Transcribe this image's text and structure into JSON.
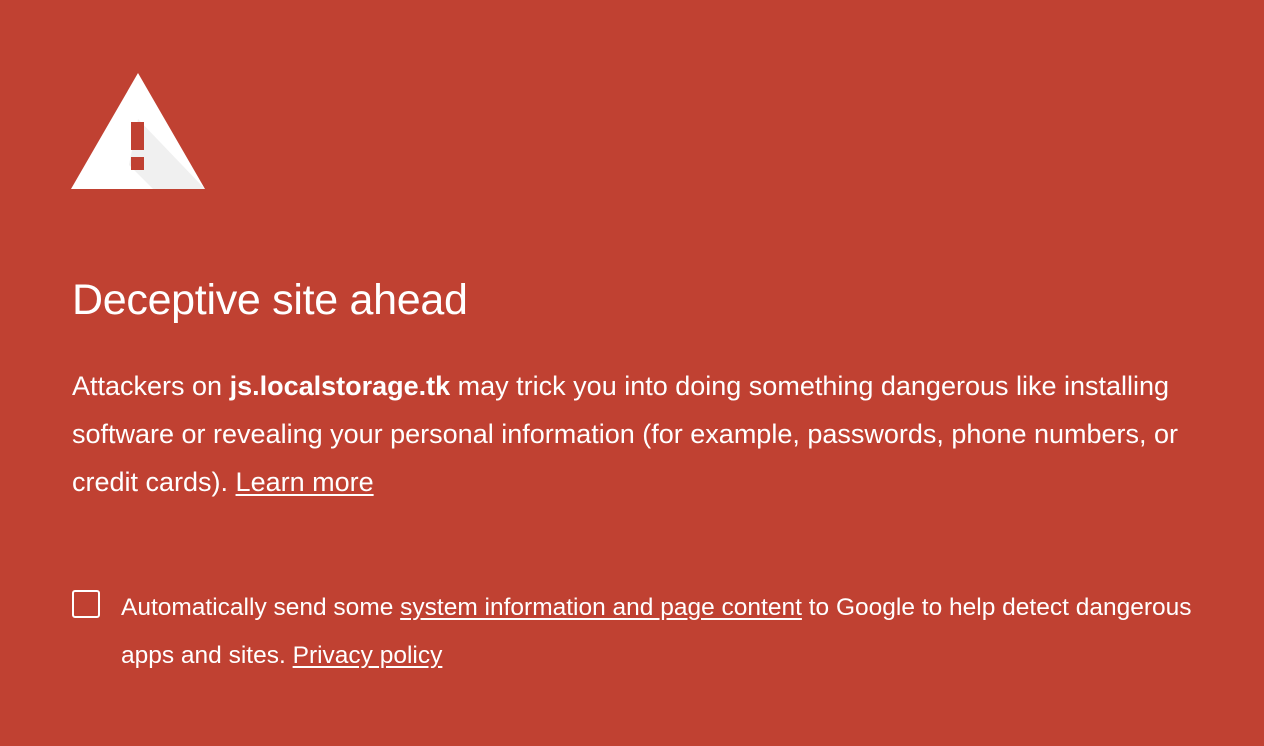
{
  "colors": {
    "background": "#c04132",
    "text": "#ffffff"
  },
  "icon": "warning-triangle-icon",
  "heading": "Deceptive site ahead",
  "message": {
    "prefix": "Attackers on ",
    "domain": "js.localstorage.tk",
    "suffix": " may trick you into doing something dangerous like installing software or revealing your personal information (for example, passwords, phone numbers, or credit cards). ",
    "learn_more": "Learn more"
  },
  "optin": {
    "checked": false,
    "prefix": "Automatically send some ",
    "link": "system information and page content",
    "middle": " to Google to help detect dangerous apps and sites. ",
    "privacy_link": "Privacy policy"
  }
}
